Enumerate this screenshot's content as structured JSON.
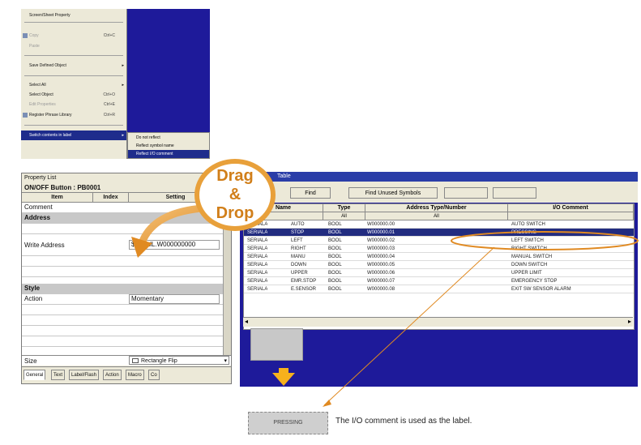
{
  "context_menu": {
    "items": [
      {
        "label": "Screen/Sheet Property",
        "shortcut": "",
        "disabled": false
      },
      {
        "label": "Copy",
        "shortcut": "Ctrl+C",
        "disabled": true
      },
      {
        "label": "Paste",
        "shortcut": "",
        "disabled": true
      },
      {
        "label": "Save Defined Object",
        "shortcut": "",
        "disabled": false
      },
      {
        "label": "Select All",
        "shortcut": "Ctrl+A",
        "disabled": false
      },
      {
        "label": "Select Object",
        "shortcut": "Ctrl+O",
        "disabled": false
      },
      {
        "label": "Edit Properties",
        "shortcut": "Ctrl+E",
        "disabled": true
      },
      {
        "label": "Register Phrase Library",
        "shortcut": "Ctrl+R",
        "disabled": false
      },
      {
        "label": "Switch contents in label",
        "shortcut": "",
        "disabled": false
      }
    ],
    "submenu": [
      "Do not reflect",
      "Reflect symbol name",
      "Reflect I/O comment"
    ]
  },
  "property_list": {
    "title": "Property List",
    "object": "ON/OFF Button : PB0001",
    "headers": [
      "Item",
      "Index",
      "Setting"
    ],
    "rows": [
      {
        "item": "Comment",
        "value": "",
        "section": false
      },
      {
        "item": "Address",
        "value": "",
        "section": true
      },
      {
        "item": "",
        "value": "",
        "section": false
      },
      {
        "item": "Write Address",
        "value": "$SerialL.W000000000",
        "section": false
      },
      {
        "item": "",
        "value": "",
        "section": false
      },
      {
        "item": "",
        "value": "",
        "section": false
      },
      {
        "item": "Style",
        "value": "",
        "section": true
      },
      {
        "item": "Action",
        "value": "Momentary",
        "section": false
      },
      {
        "item": "",
        "value": "",
        "section": false
      },
      {
        "item": "",
        "value": "",
        "section": false
      },
      {
        "item": "",
        "value": "",
        "section": false
      }
    ],
    "size_row": {
      "item": "Size",
      "value": "Rectangle Flip"
    },
    "tabs": [
      "General",
      "Text",
      "Label/Flash",
      "Action",
      "Macro",
      "Co"
    ]
  },
  "symbol_table": {
    "title": "Table",
    "toolbar": [
      "",
      "Find",
      "Find Unused Symbols",
      "",
      ""
    ],
    "headers": [
      "Name",
      "Type",
      "Address Type/Number",
      "I/O Comment"
    ],
    "filters": [
      "",
      "All",
      "All",
      ""
    ],
    "rows": [
      {
        "prefix": "SERIALA",
        "name": "AUTO",
        "type": "BOOL",
        "address": "W000000.00",
        "comment": "AUTO SWITCH"
      },
      {
        "prefix": "SERIALA",
        "name": "STOP",
        "type": "BOOL",
        "address": "W000000.01",
        "comment": "PRESSING"
      },
      {
        "prefix": "SERIALA",
        "name": "LEFT",
        "type": "BOOL",
        "address": "W000000.02",
        "comment": "LEFT SWITCH"
      },
      {
        "prefix": "SERIALA",
        "name": "RIGHT",
        "type": "BOOL",
        "address": "W000000.03",
        "comment": "RIGHT SWITCH"
      },
      {
        "prefix": "SERIALA",
        "name": "MANU",
        "type": "BOOL",
        "address": "W000000.04",
        "comment": "MANUAL SWITCH"
      },
      {
        "prefix": "SERIALA",
        "name": "DOWN",
        "type": "BOOL",
        "address": "W000000.05",
        "comment": "DOWN SWITCH"
      },
      {
        "prefix": "SERIALA",
        "name": "UPPER",
        "type": "BOOL",
        "address": "W000000.06",
        "comment": "UPPER LIMIT"
      },
      {
        "prefix": "SERIALA",
        "name": "EMR.STOP",
        "type": "BOOL",
        "address": "W000000.07",
        "comment": "EMERGENCY STOP"
      },
      {
        "prefix": "SERIALA",
        "name": "E.SENSOR",
        "type": "BOOL",
        "address": "W000000.08",
        "comment": "EXIT SW SENSOR ALARM"
      }
    ],
    "selected_index": 1
  },
  "callout": {
    "line1": "Drag",
    "line2": "&",
    "line3": "Drop"
  },
  "result_button_text": "PRESSING",
  "caption": "The I/O comment is used as the label.",
  "colors": {
    "accent_orange": "#e8a03a",
    "selection_blue": "#222c80",
    "screen_blue": "#1e1a9a"
  }
}
